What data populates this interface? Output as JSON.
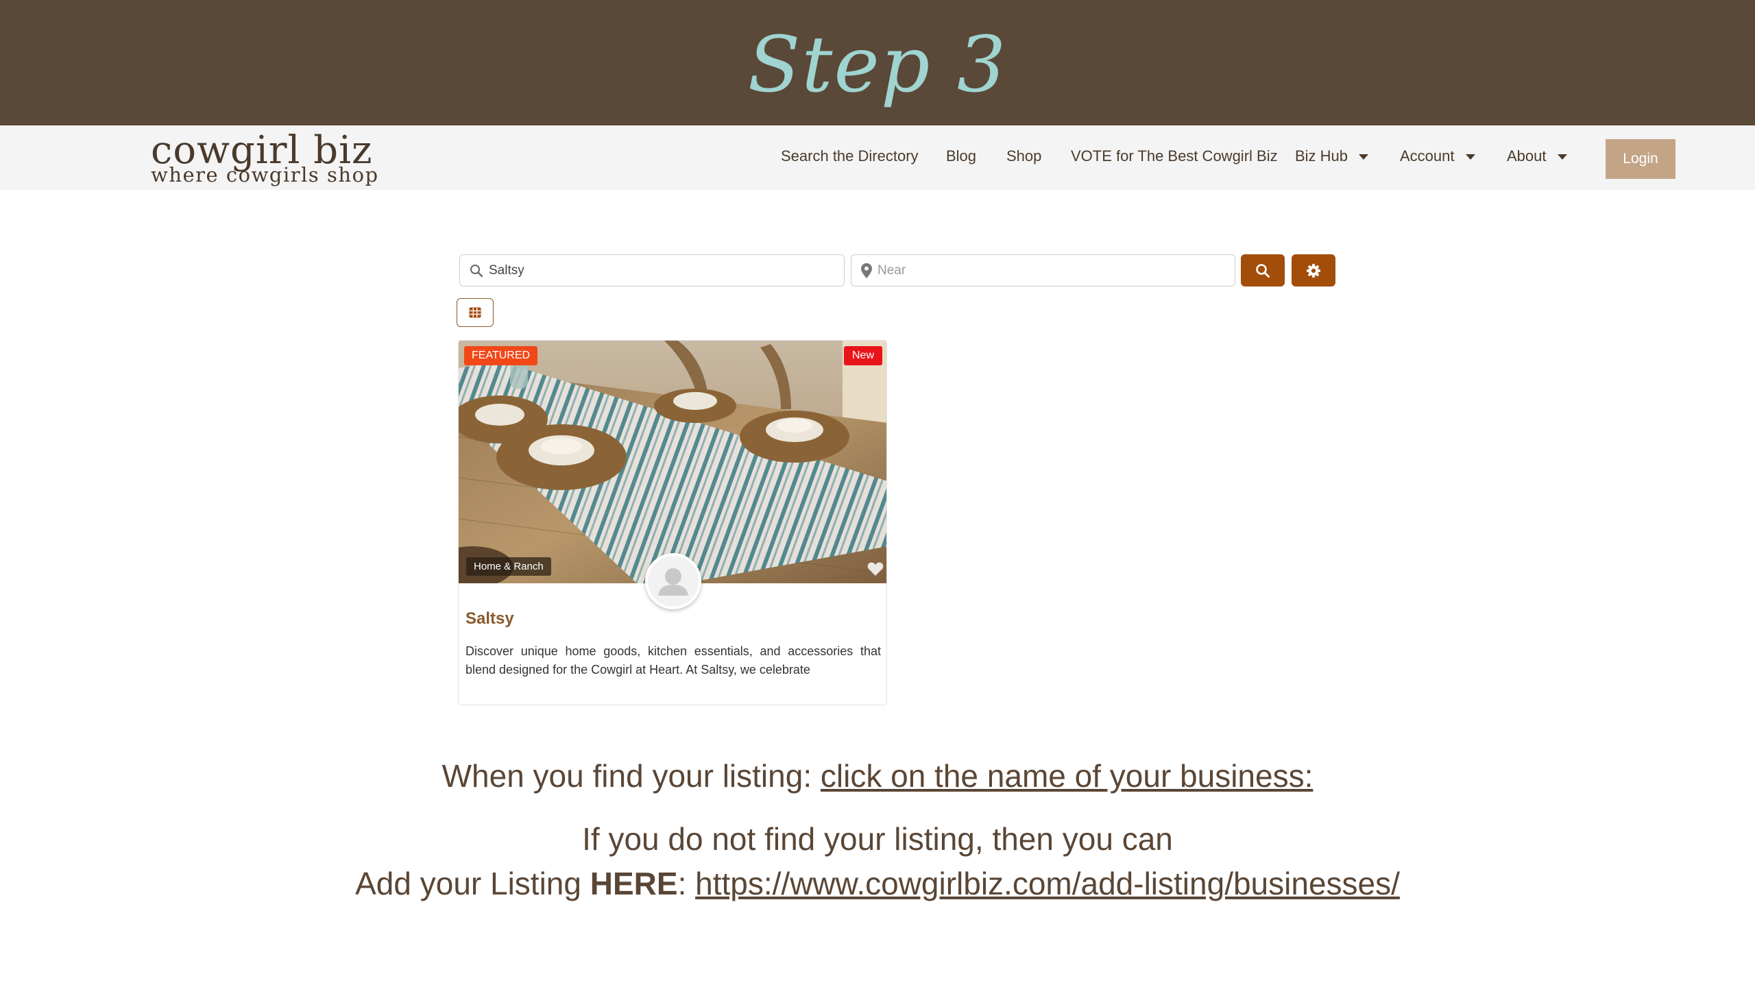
{
  "banner": {
    "title": "Step 3"
  },
  "header": {
    "logo_main": "cowgirl biz",
    "logo_sub": "where cowgirls shop",
    "nav": {
      "search_directory": "Search the Directory",
      "blog": "Blog",
      "shop": "Shop",
      "vote": "VOTE for The Best Cowgirl Biz",
      "biz_hub": "Biz Hub",
      "account": "Account",
      "about": "About"
    },
    "login_label": "Login"
  },
  "search": {
    "query_value": "Saltsy",
    "near_placeholder": "Near"
  },
  "listing": {
    "badge_featured": "FEATURED",
    "badge_new": "New",
    "category": "Home & Ranch",
    "title": "Saltsy",
    "description": "Discover unique home goods, kitchen essentials, and accessories that blend designed for the Cowgirl at Heart. At Saltsy, we celebrate"
  },
  "instructions": {
    "line1_prefix": "When you find your listing: ",
    "line1_link": "click on the name of your business:",
    "line2": "If you do not find your listing, then you can",
    "line3_prefix": "Add your Listing ",
    "line3_bold": "HERE",
    "line3_colon": ": ",
    "line3_link": "https://www.cowgirlbiz.com/add-listing/businesses/"
  },
  "colors": {
    "banner_bg": "#5a4938",
    "banner_title": "#9fd4d1",
    "accent_button": "#a34d0b",
    "login_bg": "#c4a487",
    "listing_title": "#8a5a2b",
    "badge_featured": "#f24818",
    "badge_new": "#e8141a"
  },
  "icons": {
    "search": "search-icon",
    "location": "map-pin-icon",
    "settings": "gear-icon",
    "grid": "grid-icon",
    "favorite": "heart-icon",
    "avatar": "user-avatar-icon"
  }
}
